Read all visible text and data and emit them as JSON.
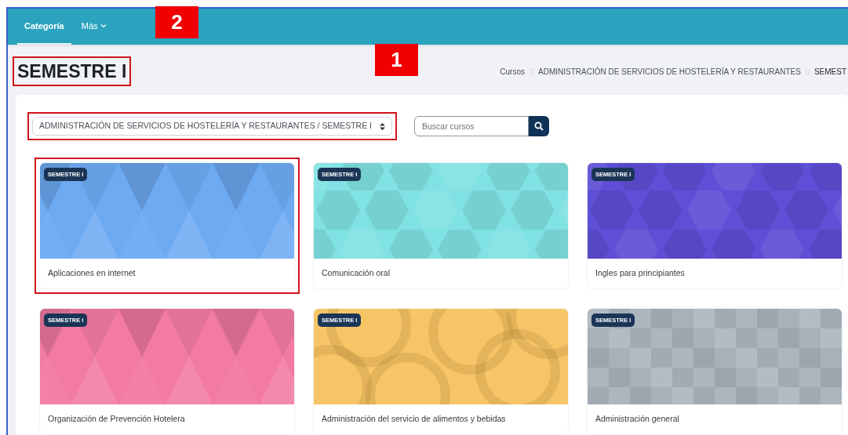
{
  "tabs": [
    {
      "label": "Categoría",
      "selected": true,
      "kind": "link"
    },
    {
      "label": "Más",
      "selected": false,
      "kind": "dropdown"
    }
  ],
  "page_title": {
    "text": "SEMESTRE I",
    "highlighted": true
  },
  "breadcrumb": [
    "Cursos",
    "ADMINISTRACIÓN DE SERVICIOS DE HOSTELERÍA Y RESTAURANTES",
    "SEMEST"
  ],
  "category_select": {
    "value": "ADMINISTRACIÓN DE SERVICIOS DE HOSTELERÍA Y RESTAURANTES / SEMESTRE I",
    "highlighted": true
  },
  "search": {
    "placeholder": "Buscar cursos"
  },
  "courses": [
    {
      "badge": "SEMESTRE I",
      "name": "Aplicaciones en internet",
      "color": "#6daaf2",
      "kind": "triangles",
      "highlighted": true
    },
    {
      "badge": "SEMESTRE I",
      "name": "Comunicación oral",
      "color": "#80e2e2",
      "kind": "hexagons",
      "highlighted": false
    },
    {
      "badge": "SEMESTRE I",
      "name": "Ingles para principiantes",
      "color": "#5e4fd6",
      "kind": "hexagons",
      "highlighted": false
    },
    {
      "badge": "SEMESTRE I",
      "name": "Organización de Prevención Hotelera",
      "color": "#f27aa3",
      "kind": "triangles",
      "highlighted": false
    },
    {
      "badge": "SEMESTRE I",
      "name": "Administración del servicio de alimentos y bebidas",
      "color": "#f7c566",
      "kind": "circles",
      "highlighted": false
    },
    {
      "badge": "SEMESTRE I",
      "name": "Administración general",
      "color": "#b2bcc4",
      "kind": "squares",
      "highlighted": false
    }
  ],
  "callouts": [
    {
      "label": "2"
    },
    {
      "label": "1"
    }
  ]
}
